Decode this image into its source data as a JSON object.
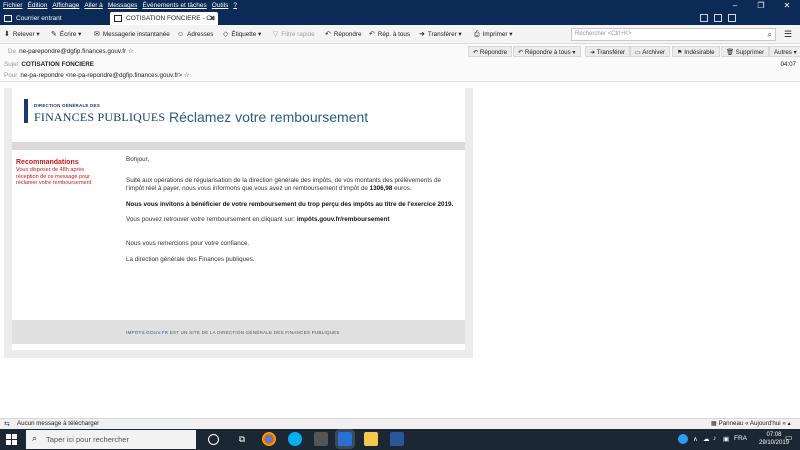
{
  "menubar": {
    "items": [
      "Fichier",
      "Édition",
      "Affichage",
      "Aller à",
      "Messages",
      "Événements et tâches",
      "Outils",
      "?"
    ]
  },
  "tabs": [
    {
      "label": "Courrier entrant",
      "icon": "inbox-icon"
    },
    {
      "label": "COTISATION FONCIERE - Co",
      "icon": "envelope-icon"
    }
  ],
  "toolbar": {
    "get_mail": "Relever",
    "write": "Écrire",
    "chat": "Messagerie instantanée",
    "address_book": "Adresses",
    "tag": "Étiquette",
    "quick_filter": "Filtre rapide",
    "reply": "Répondre",
    "reply_all": "Rép. à tous",
    "forward": "Transférer",
    "print": "Imprimer",
    "search_placeholder": "Rechercher <Ctrl+K>"
  },
  "header": {
    "from_label": "De",
    "from": "ne-parepondre@dgfip.finances.gouv.fr",
    "subject_label": "Sujet",
    "subject": "COTISATION FONCIERE",
    "to_label": "Pour",
    "to": "ne-pa-repondre <ne-pa-repondre@dgfip.finances.gouv.fr>",
    "time": "04:07",
    "buttons": {
      "reply": "Répondre",
      "reply_all": "Répondre à tous",
      "forward": "Transférer",
      "archive": "Archiver",
      "junk": "Indésirable",
      "delete": "Supprimer",
      "other": "Autres"
    }
  },
  "email": {
    "logo_small": "DIRECTION GÉNÉRALE DES",
    "logo_big": "FINANCES PUBLIQUES",
    "headline": "Réclamez votre remboursement",
    "reco_title": "Recommandations",
    "reco_text": "Vous disposer de 48h après réception de ce message pour réclamer votre remboursement",
    "greeting": "Bonjour,",
    "p1": "Suite aux opérations de régularisation de la direction générale des impôts, de vos montants des prélèvements de l'impôt réel à payer, nous vous informons que vous avez un remboursement d'impôt de",
    "amount": "1306,98",
    "p1_end": "euros.",
    "p2": "Nous vous invitons à bénéficier de votre remboursement du trop perçu des impôts au titre de l'exercice 2019.",
    "p3": "Vous pouvez retrouver votre remboursement en cliquant sur:",
    "link": "impôts.gouv.fr/remboursement",
    "p4": "Nous vous remercions pour votre confiance.",
    "p5": "La direction générale des Finances publiques.",
    "footer_link": "IMPOTS.GOUV.FR",
    "footer_text": "EST UN SITE DE LA DIRECTION GÉNÉRALE DES FINANCES PUBLIQUES"
  },
  "statusbar": {
    "text": "Aucun message à télécharger",
    "panel": "Panneau « Aujourd'hui »"
  },
  "taskbar": {
    "search_placeholder": "Taper ici pour rechercher",
    "lang": "FRA",
    "time": "07:08",
    "date": "29/10/2019"
  },
  "colors": {
    "titlebar": "#0b2a55",
    "headline": "#2b5b86",
    "warning": "#c01b1b",
    "taskbar": "#1b2733"
  }
}
